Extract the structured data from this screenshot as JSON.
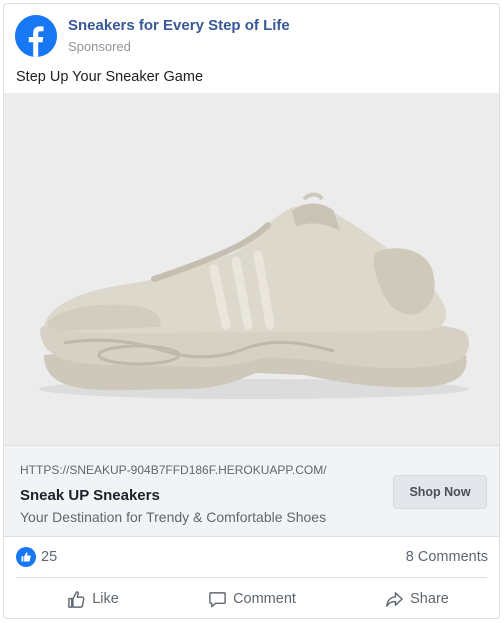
{
  "post": {
    "page_name": "Sneakers for Every Step of Life",
    "sponsored_label": "Sponsored",
    "caption": "Step Up Your Sneaker Game"
  },
  "link": {
    "url": "HTTPS://SNEAKUP-904B7FFD186F.HEROKUAPP.COM/",
    "title": "Sneak UP Sneakers",
    "description": "Your Destination for Trendy & Comfortable Shoes",
    "cta_label": "Shop Now"
  },
  "stats": {
    "like_count": "25",
    "comments_label": "8 Comments"
  },
  "actions": {
    "like_label": "Like",
    "comment_label": "Comment",
    "share_label": "Share"
  },
  "icons": {
    "avatar": "facebook-logo-icon",
    "reaction": "thumbs-up-icon",
    "like": "thumbs-up-outline-icon",
    "comment": "speech-bubble-icon",
    "share": "share-arrow-icon"
  },
  "colors": {
    "brand_blue": "#1877f2",
    "page_name": "#385898",
    "secondary_text": "#606770",
    "link_bg": "#f2f3f5",
    "media_bg": "#ececec",
    "shoe": "#d8d3c6"
  }
}
